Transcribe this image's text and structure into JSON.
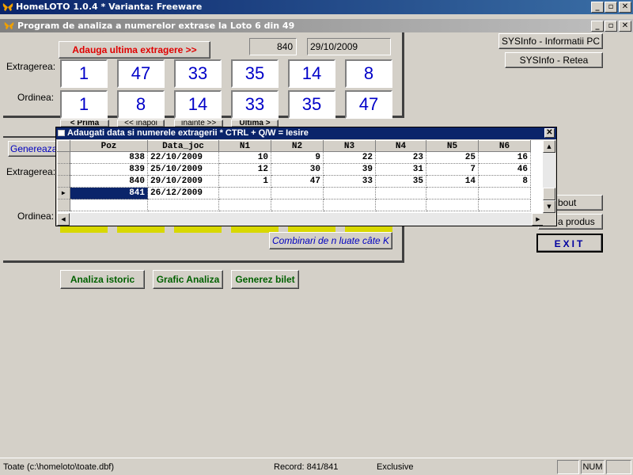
{
  "window": {
    "title": "HomeLOTO 1.0.4 * Varianta: Freeware"
  },
  "subwindow": {
    "title": "Program de analiza a numerelor extrase la Loto 6 din 49"
  },
  "top": {
    "add_last_draw_label": "Adauga ultima extragere >>",
    "record_no": "840",
    "record_date": "29/10/2009",
    "draw_label": "Extragerea:",
    "order_label": "Ordinea:",
    "draw_numbers": [
      "1",
      "47",
      "33",
      "35",
      "14",
      "8"
    ],
    "order_numbers": [
      "1",
      "8",
      "14",
      "33",
      "35",
      "47"
    ],
    "nav": [
      "< Prima",
      "<< înapoi",
      "înainte >>",
      "Ultima >"
    ]
  },
  "right": {
    "sysinfo_pc": "SYSInfo - Informatii PC",
    "sysinfo_net": "SYSInfo - Retea",
    "about": "bout",
    "produs": "a produs",
    "exit": "EXIT"
  },
  "lower": {
    "generate_partial": "Genereaza",
    "draw_label": "Extragerea:",
    "order_label": "Ordinea:",
    "combinari": "Combinari de n luate câte K"
  },
  "bottom_buttons": {
    "analiza": "Analiza istoric",
    "grafic": "Grafic Analiza",
    "bilet": "Generez bilet"
  },
  "grid": {
    "title": "Adaugati data si numerele extragerii  * CTRL + Q/W = Iesire",
    "columns": [
      "Poz",
      "Data_joc",
      "N1",
      "N2",
      "N3",
      "N4",
      "N5",
      "N6"
    ],
    "rows": [
      [
        "838",
        "22/10/2009",
        "10",
        "9",
        "22",
        "23",
        "25",
        "16"
      ],
      [
        "839",
        "25/10/2009",
        "12",
        "30",
        "39",
        "31",
        "7",
        "46"
      ],
      [
        "840",
        "29/10/2009",
        "1",
        "47",
        "33",
        "35",
        "14",
        "8"
      ],
      [
        "841",
        "26/12/2009",
        "",
        "",
        "",
        "",
        "",
        ""
      ]
    ]
  },
  "status": {
    "file": "Toate (c:\\homeloto\\toate.dbf)",
    "record": "Record: 841/841",
    "mode": "Exclusive",
    "num": "NUM"
  },
  "colors": {
    "title_active": "#0a246a",
    "number_blue": "#0000c8",
    "red_button": "#e00000",
    "green_button": "#006000"
  }
}
